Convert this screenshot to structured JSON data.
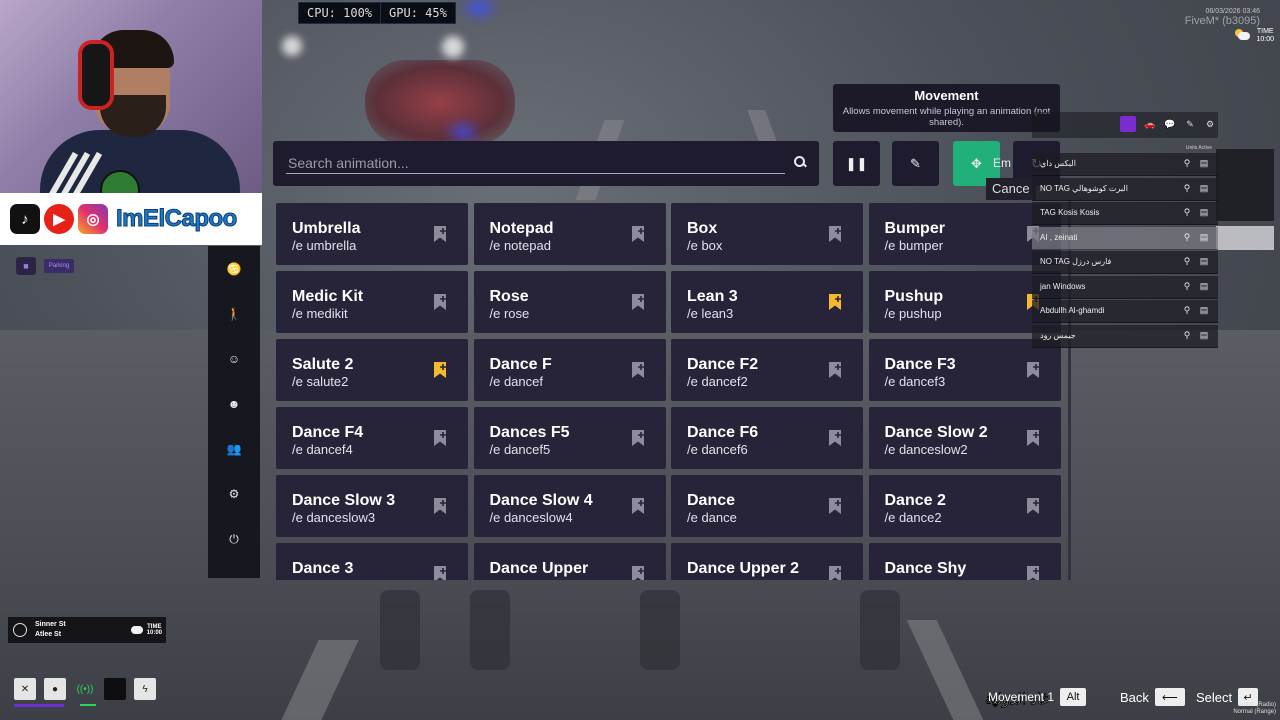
{
  "webcam": {
    "channel_name": "ImElCapoo",
    "social_icons": [
      "tiktok-icon",
      "youtube-icon",
      "instagram-icon"
    ]
  },
  "stats": {
    "cpu": "CPU: 100%",
    "gpu": "GPU: 45%"
  },
  "top_right": {
    "date": "06/03/2026 03:46",
    "title": "FiveM* (b3095)",
    "time_label": "TIME",
    "time_value": "10:00"
  },
  "parking": {
    "label": "Parking"
  },
  "tooltip": {
    "title": "Movement",
    "description": "Allows movement while playing an animation (not shared)."
  },
  "search": {
    "placeholder": "Search animation...",
    "value": ""
  },
  "toolbar": {
    "cut_label": "Em",
    "cancel_label": "Cance"
  },
  "emotes": [
    {
      "label": "Umbrella",
      "command": "/e umbrella",
      "favorite": false
    },
    {
      "label": "Notepad",
      "command": "/e notepad",
      "favorite": false
    },
    {
      "label": "Box",
      "command": "/e box",
      "favorite": false
    },
    {
      "label": "Bumper",
      "command": "/e bumper",
      "favorite": false
    },
    {
      "label": "Medic Kit",
      "command": "/e medikit",
      "favorite": false
    },
    {
      "label": "Rose",
      "command": "/e rose",
      "favorite": false
    },
    {
      "label": "Lean 3",
      "command": "/e lean3",
      "favorite": true
    },
    {
      "label": "Pushup",
      "command": "/e pushup",
      "favorite": true
    },
    {
      "label": "Salute 2",
      "command": "/e salute2",
      "favorite": true
    },
    {
      "label": "Dance F",
      "command": "/e dancef",
      "favorite": false
    },
    {
      "label": "Dance F2",
      "command": "/e dancef2",
      "favorite": false
    },
    {
      "label": "Dance F3",
      "command": "/e dancef3",
      "favorite": false
    },
    {
      "label": "Dance F4",
      "command": "/e dancef4",
      "favorite": false
    },
    {
      "label": "Dances F5",
      "command": "/e dancef5",
      "favorite": false
    },
    {
      "label": "Dance F6",
      "command": "/e dancef6",
      "favorite": false
    },
    {
      "label": "Dance Slow 2",
      "command": "/e danceslow2",
      "favorite": false
    },
    {
      "label": "Dance Slow 3",
      "command": "/e danceslow3",
      "favorite": false
    },
    {
      "label": "Dance Slow 4",
      "command": "/e danceslow4",
      "favorite": false
    },
    {
      "label": "Dance",
      "command": "/e dance",
      "favorite": false
    },
    {
      "label": "Dance 2",
      "command": "/e dance2",
      "favorite": false
    },
    {
      "label": "Dance 3",
      "command": "",
      "favorite": false
    },
    {
      "label": "Dance Upper",
      "command": "",
      "favorite": false
    },
    {
      "label": "Dance Upper 2",
      "command": "",
      "favorite": false
    },
    {
      "label": "Dance Shy",
      "command": "",
      "favorite": false
    }
  ],
  "colors": {
    "favorite": "#f5b92e",
    "inactive_bookmark": "#8e8c9c",
    "accent_active": "#21b07a",
    "card_bg": "#272439"
  },
  "player_list": {
    "units_active": "Units Active",
    "rows": [
      {
        "name": "البكس داي"
      },
      {
        "name": "NO TAG البرت كوشوهالي"
      },
      {
        "name": "TAG Kosis Kosis"
      },
      {
        "name": "AI , zeinati"
      },
      {
        "name": "NO TAG فارس درزل"
      },
      {
        "name": "jan Windows"
      },
      {
        "name": "Abdullh Al-ghamdi"
      },
      {
        "name": "جيمس رود"
      }
    ]
  },
  "street": {
    "primary": "Sinner St",
    "secondary": "Atlee St",
    "time_label": "TIME",
    "time_value": "10:00"
  },
  "controls": {
    "arabic_label": "غاد الدولية",
    "movement_label": "Movement 1",
    "movement_key": "Alt",
    "back_label": "Back",
    "select_label": "Select",
    "mode_line1": "Active (Radio)",
    "mode_line2": "Normal (Range)"
  }
}
